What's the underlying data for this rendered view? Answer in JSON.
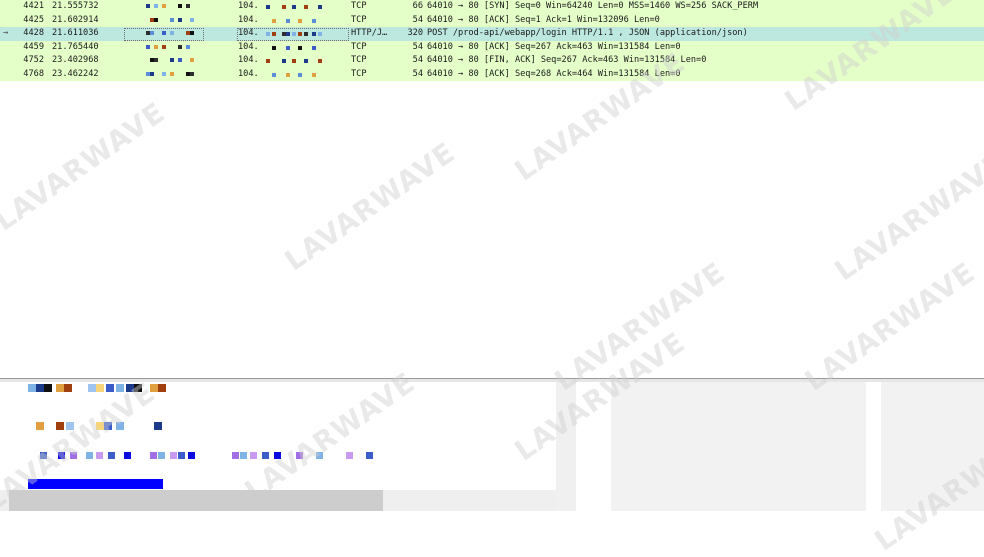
{
  "packets": [
    {
      "no": "4421",
      "time": "21.555732",
      "src": "",
      "dst": "104.",
      "proto": "TCP",
      "len": "66",
      "info": "64010 → 80 [SYN] Seq=0 Win=64240 Len=0 MSS=1460 WS=256 SACK_PERM",
      "selected": false
    },
    {
      "no": "4425",
      "time": "21.602914",
      "src": "",
      "dst": "104.",
      "proto": "TCP",
      "len": "54",
      "info": "64010 → 80 [ACK] Seq=1 Ack=1 Win=132096 Len=0",
      "selected": false
    },
    {
      "no": "4428",
      "time": "21.611036",
      "src": "",
      "dst": "104.",
      "proto": "HTTP/J…",
      "len": "320",
      "info": "POST /prod-api/webapp/login HTTP/1.1 , JSON (application/json)",
      "selected": true
    },
    {
      "no": "4459",
      "time": "21.765440",
      "src": "",
      "dst": "104.",
      "proto": "TCP",
      "len": "54",
      "info": "64010 → 80 [ACK] Seq=267 Ack=463 Win=131584 Len=0",
      "selected": false
    },
    {
      "no": "4752",
      "time": "23.402968",
      "src": "",
      "dst": "104.",
      "proto": "TCP",
      "len": "54",
      "info": "64010 → 80 [FIN, ACK] Seq=267 Ack=463 Win=131584 Len=0",
      "selected": false
    },
    {
      "no": "4768",
      "time": "23.462242",
      "src": "",
      "dst": "104.",
      "proto": "TCP",
      "len": "54",
      "info": "64010 → 80 [ACK] Seq=268 Ack=464 Win=131584 Len=0",
      "selected": false
    }
  ],
  "watermark": "LAVARWAVE",
  "colors": {
    "row_bg": "#e4ffc7",
    "selected_bg": "#bde8df",
    "highlight_blue": "#0a79dd",
    "field_blue": "#0000ff"
  }
}
